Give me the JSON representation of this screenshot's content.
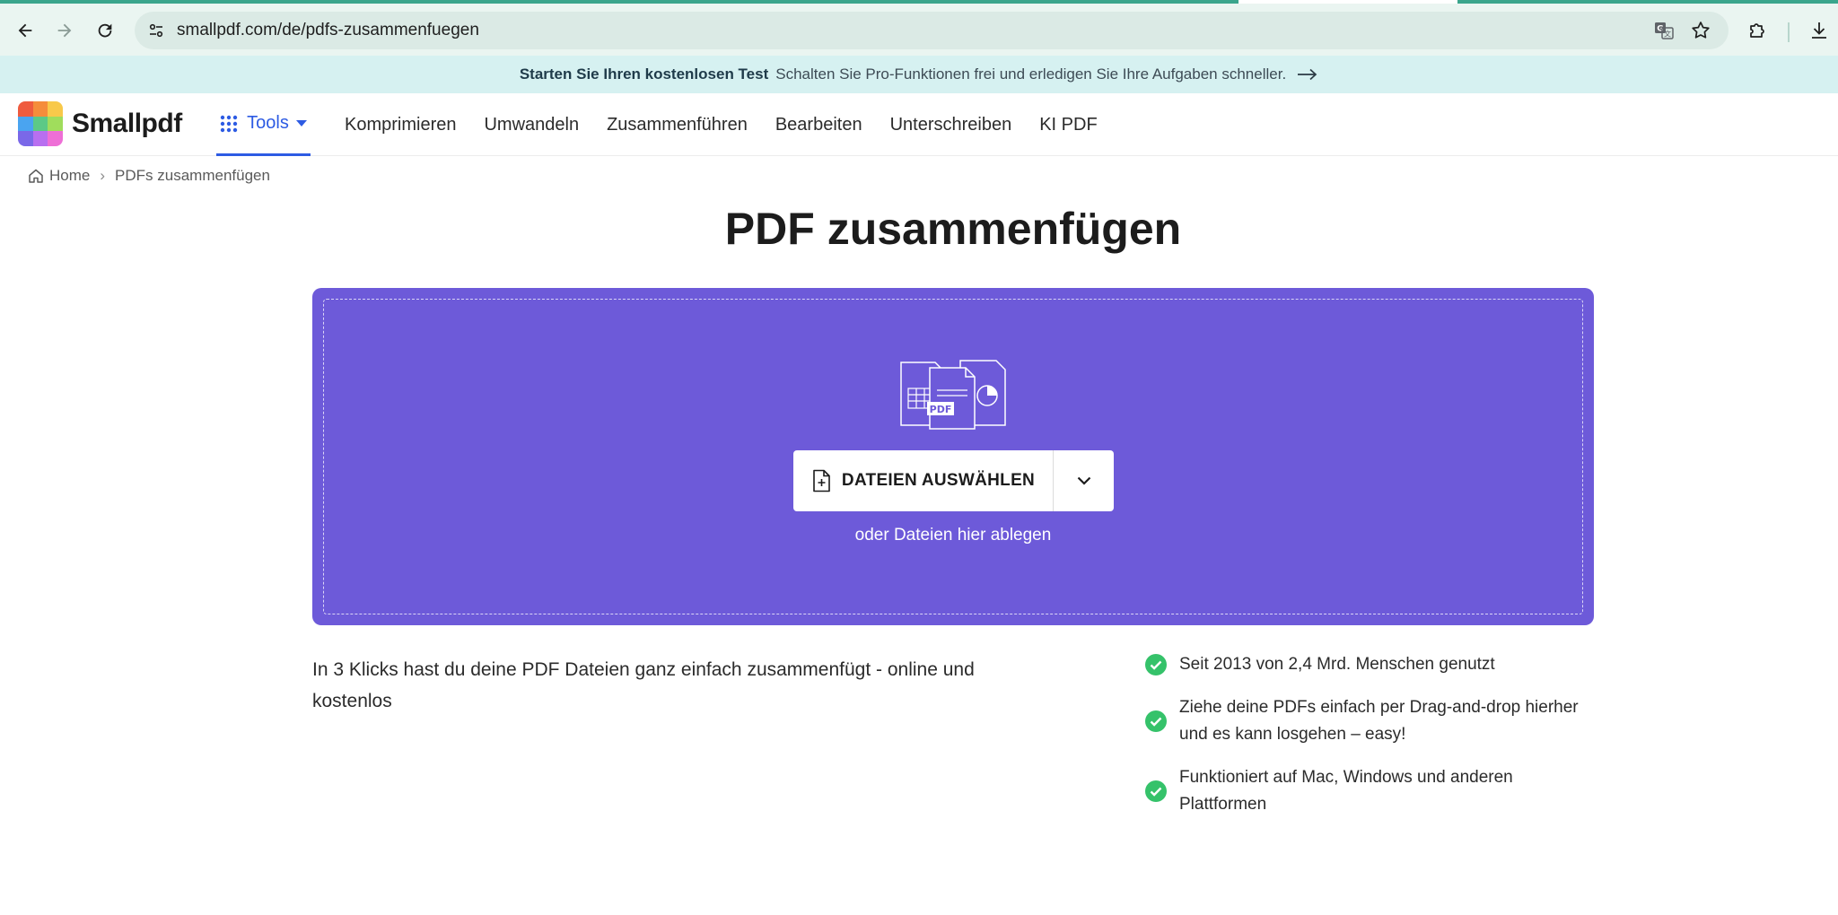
{
  "browser": {
    "url": "smallpdf.com/de/pdfs-zusammenfuegen",
    "colors": {
      "toolbar": "#eaf5f1",
      "omnibox": "#dbeae5",
      "tab_accent": "#3aa58c"
    }
  },
  "promo": {
    "title": "Starten Sie Ihren kostenlosen Test",
    "text": "Schalten Sie Pro-Funktionen frei und erledigen Sie Ihre Aufgaben schneller.",
    "background": "#d6f1f1"
  },
  "header": {
    "logo_text": "Smallpdf",
    "tools_label": "Tools",
    "nav": [
      "Komprimieren",
      "Umwandeln",
      "Zusammenführen",
      "Bearbeiten",
      "Unterschreiben",
      "KI PDF"
    ],
    "accent": "#2d5be3"
  },
  "breadcrumb": {
    "home": "Home",
    "current": "PDFs zusammenfügen"
  },
  "main": {
    "title": "PDF zusammenfügen",
    "dropzone_color": "#6d5ad9",
    "choose_button": "DATEIEN AUSWÄHLEN",
    "drop_hint": "oder Dateien hier ablegen",
    "illustration_label": "PDF"
  },
  "description": "In 3 Klicks hast du deine PDF Dateien ganz einfach zusammenfügt - online und kostenlos",
  "features": [
    "Seit 2013 von 2,4 Mrd. Menschen genutzt",
    "Ziehe deine PDFs einfach per Drag-and-drop hierher und es kann losgehen – easy!",
    "Funktioniert auf Mac, Windows und anderen Plattformen"
  ],
  "feature_check_color": "#35c26a",
  "icons": [
    "back-icon",
    "forward-icon",
    "reload-icon",
    "site-info-icon",
    "translate-icon",
    "star-icon",
    "extensions-icon",
    "download-icon",
    "grid-icon",
    "chevron-down-icon",
    "home-icon",
    "file-add-icon",
    "check-icon",
    "arrow-right-icon"
  ]
}
